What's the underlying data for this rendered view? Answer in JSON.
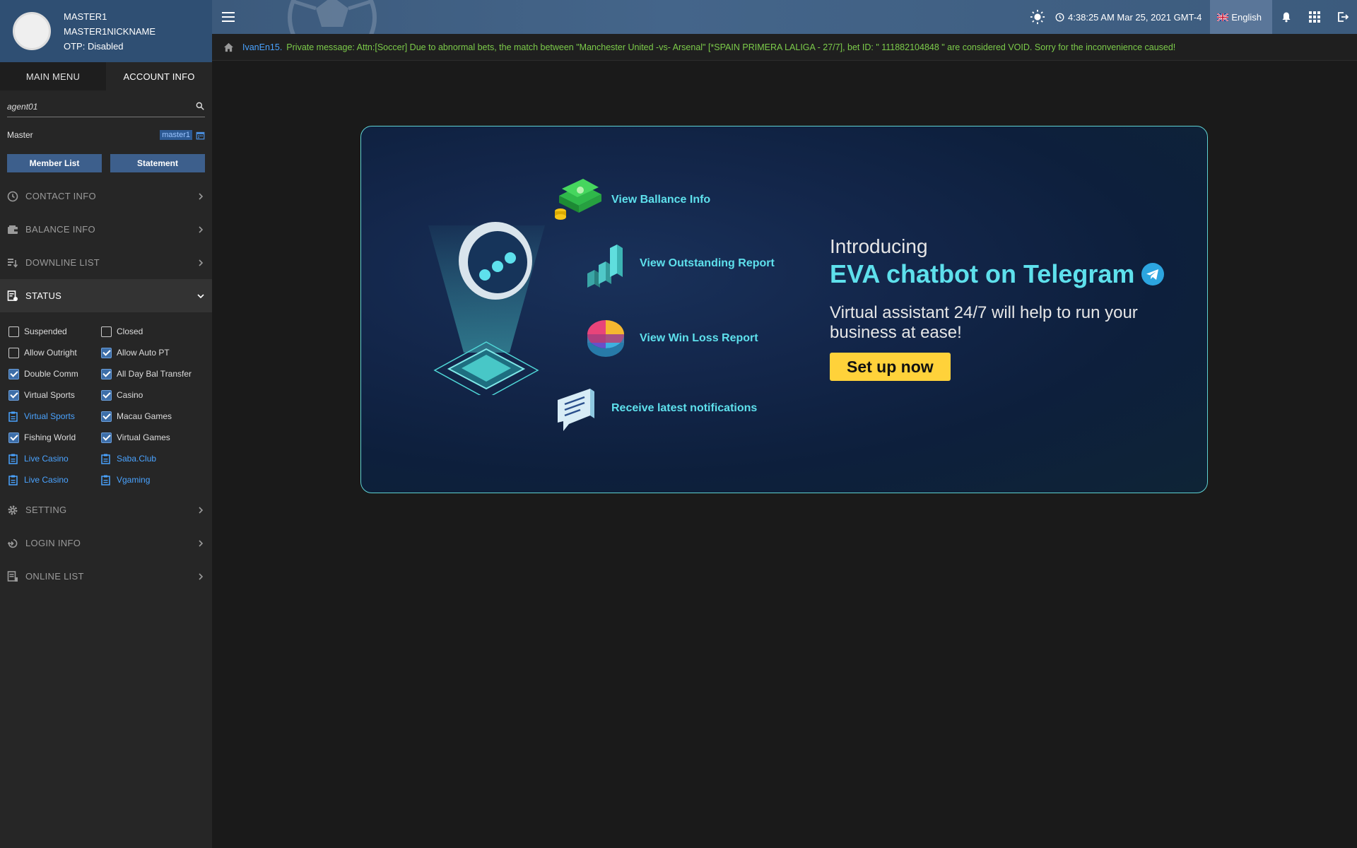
{
  "user": {
    "name": "MASTER1",
    "nickname": "MASTER1NICKNAME",
    "otp": "OTP: Disabled"
  },
  "sidebar": {
    "tabs": [
      {
        "label": "MAIN MENU",
        "active": false
      },
      {
        "label": "ACCOUNT INFO",
        "active": true
      }
    ],
    "search": {
      "value": "agent01",
      "placeholder": ""
    },
    "role": {
      "label": "Master",
      "value": "master1"
    },
    "buttons": {
      "member_list": "Member List",
      "statement": "Statement"
    },
    "sections": {
      "contact": "CONTACT INFO",
      "balance": "BALANCE INFO",
      "downline": "DOWNLINE LIST",
      "status": "STATUS",
      "setting": "SETTING",
      "login": "LOGIN INFO",
      "online": "ONLINE LIST"
    },
    "status_items": [
      {
        "label": "Suspended",
        "type": "checkbox",
        "checked": false
      },
      {
        "label": "Closed",
        "type": "checkbox",
        "checked": false
      },
      {
        "label": "Allow Outright",
        "type": "checkbox",
        "checked": false
      },
      {
        "label": "Allow Auto PT",
        "type": "checkbox",
        "checked": true
      },
      {
        "label": "Double Comm",
        "type": "checkbox",
        "checked": true
      },
      {
        "label": "All Day Bal Transfer",
        "type": "checkbox",
        "checked": true
      },
      {
        "label": "Virtual Sports",
        "type": "checkbox",
        "checked": true
      },
      {
        "label": "Casino",
        "type": "checkbox",
        "checked": true
      },
      {
        "label": "Virtual Sports",
        "type": "link",
        "checked": false
      },
      {
        "label": "Macau Games",
        "type": "checkbox",
        "checked": true
      },
      {
        "label": "Fishing World",
        "type": "checkbox",
        "checked": true
      },
      {
        "label": "Virtual Games",
        "type": "checkbox",
        "checked": true
      },
      {
        "label": "Live Casino",
        "type": "link",
        "checked": false
      },
      {
        "label": "Saba.Club",
        "type": "link",
        "checked": false
      },
      {
        "label": "Live Casino",
        "type": "link",
        "checked": false
      },
      {
        "label": "Vgaming",
        "type": "link",
        "checked": false
      }
    ]
  },
  "topbar": {
    "datetime": "4:38:25 AM Mar 25, 2021 GMT-4",
    "language": "English"
  },
  "marquee": {
    "user": "IvanEn15.",
    "text": "Private message: Attn:[Soccer] Due to abnormal bets, the match between \"Manchester United -vs- Arsenal\" [*SPAIN PRIMERA LALIGA - 27/7], bet ID: \" 111882104848 \" are considered VOID. Sorry for the inconvenience caused!"
  },
  "banner": {
    "features": {
      "balance": "View Ballance Info",
      "outstanding": "View Outstanding Report",
      "winloss": "View Win Loss Report",
      "notify": "Receive latest notifications"
    },
    "intro": "Introducing",
    "title": "EVA chatbot on Telegram",
    "subtitle": "Virtual assistant 24/7 will help to run your business at ease!",
    "cta": "Set up now"
  },
  "colors": {
    "accent_cyan": "#5ee0ec",
    "cta_yellow": "#ffd23a",
    "link_blue": "#4aa3ff",
    "marquee_green": "#7ccb4a",
    "profile_blue": "#2f4f73"
  }
}
